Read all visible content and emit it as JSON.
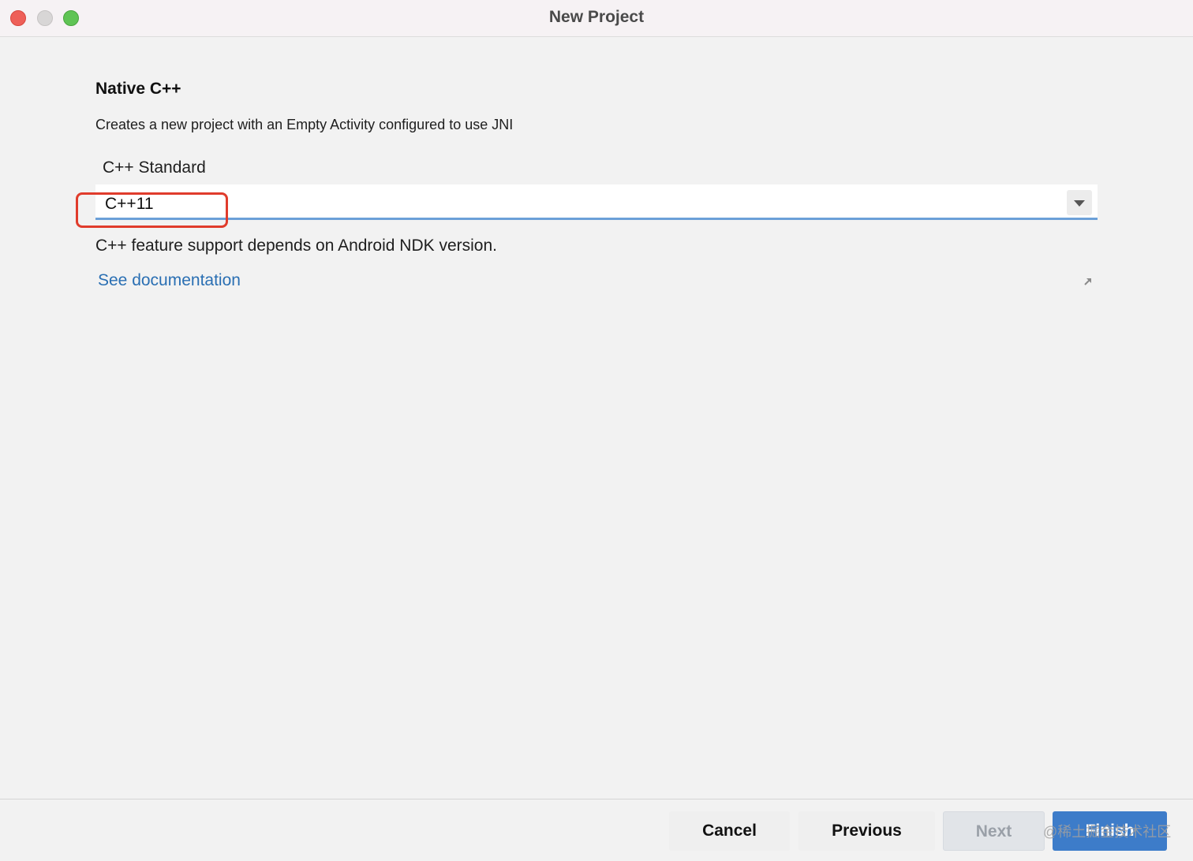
{
  "window": {
    "title": "New Project"
  },
  "content": {
    "heading": "Native C++",
    "description": "Creates a new project with an Empty Activity configured to use JNI",
    "standard_label": "C++ Standard",
    "standard_value": "C++11",
    "hint": "C++ feature support depends on Android NDK version.",
    "doc_link": "See documentation"
  },
  "buttons": {
    "cancel": "Cancel",
    "previous": "Previous",
    "next": "Next",
    "finish": "Finish"
  },
  "watermark": "@稀土掘金技术社区",
  "colors": {
    "accent": "#3d7cc9",
    "link": "#2a6fb3",
    "annotation": "#e03c2c"
  },
  "icons": {
    "external_link": "external-link-icon",
    "dropdown": "chevron-down-icon"
  }
}
